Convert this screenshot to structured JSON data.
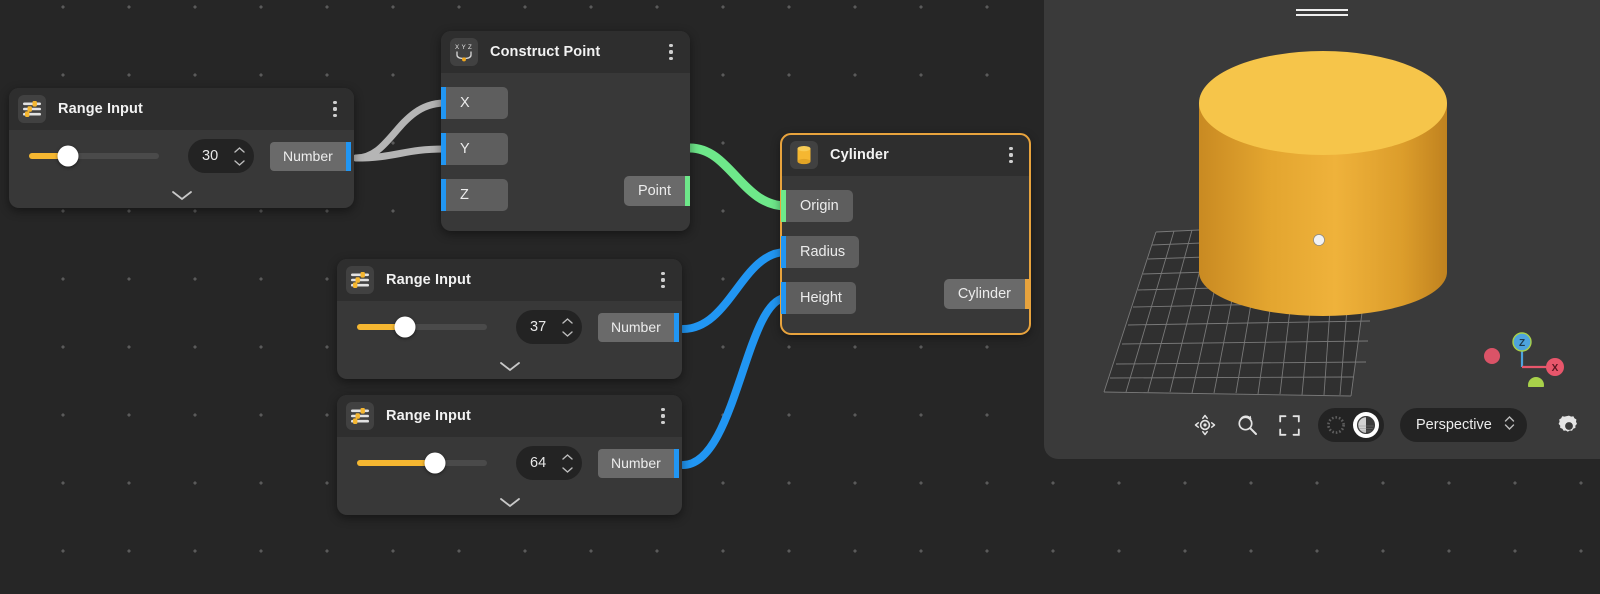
{
  "canvas": {
    "background_color": "#262626",
    "dot_color": "#5a5a5a"
  },
  "accent": {
    "selected_node_border": "#E8A33D",
    "slider_fill": "#F5B731",
    "number_cable": "#B5B5B5",
    "point_cable": "#6EE88A",
    "value_cable": "#2196F3",
    "port_blue": "#2196F3",
    "port_green": "#6EE88A"
  },
  "nodes": [
    {
      "id": "range-input-1",
      "title": "Range Input",
      "icon": "sliders-icon",
      "value": "30",
      "slider_percent": 30,
      "output_label": "Number",
      "menu_icon": "kebab-menu-icon",
      "collapse_icon": "chevron-down-icon",
      "stepper_up_icon": "chevron-up-icon",
      "stepper_down_icon": "chevron-down-icon"
    },
    {
      "id": "range-input-2",
      "title": "Range Input",
      "icon": "sliders-icon",
      "value": "37",
      "slider_percent": 37,
      "output_label": "Number",
      "menu_icon": "kebab-menu-icon",
      "collapse_icon": "chevron-down-icon",
      "stepper_up_icon": "chevron-up-icon",
      "stepper_down_icon": "chevron-down-icon"
    },
    {
      "id": "range-input-3",
      "title": "Range Input",
      "icon": "sliders-icon",
      "value": "64",
      "slider_percent": 60,
      "output_label": "Number",
      "menu_icon": "kebab-menu-icon",
      "collapse_icon": "chevron-down-icon",
      "stepper_up_icon": "chevron-up-icon",
      "stepper_down_icon": "chevron-down-icon"
    },
    {
      "id": "construct-point",
      "title": "Construct Point",
      "icon": "xyz-point-icon",
      "menu_icon": "kebab-menu-icon",
      "inputs": [
        {
          "label": "X",
          "port_color": "#2196F3"
        },
        {
          "label": "Y",
          "port_color": "#2196F3"
        },
        {
          "label": "Z",
          "port_color": "#2196F3"
        }
      ],
      "outputs": [
        {
          "label": "Point",
          "port_color": "#6EE88A"
        }
      ]
    },
    {
      "id": "cylinder",
      "title": "Cylinder",
      "icon": "cylinder-icon",
      "menu_icon": "kebab-menu-icon",
      "selected": true,
      "inputs": [
        {
          "label": "Origin",
          "port_color": "#6EE88A"
        },
        {
          "label": "Radius",
          "port_color": "#2196F3"
        },
        {
          "label": "Height",
          "port_color": "#2196F3"
        }
      ],
      "outputs": [
        {
          "label": "Cylinder",
          "port_color": "#E8A33D"
        }
      ]
    }
  ],
  "viewport": {
    "drag_handle_icon": "drag-handle-icon",
    "background_color": "#3A3A3A",
    "object_color": "#E8A83C",
    "object_top_color": "#F6C košice",
    "toolbar": {
      "pan_label": "",
      "pan_icon": "pan-orbit-icon",
      "zoom_icon": "zoom-search-icon",
      "fit_icon": "fit-to-screen-icon",
      "shading_wireframe_icon": "wireframe-shading-icon",
      "shading_shaded_icon": "shaded-view-icon",
      "projection": "Perspective",
      "projection_chevrons_icon": "chevron-up-down-icon",
      "settings_icon": "gear-icon"
    },
    "gizmo": {
      "z_label": "Z",
      "x_label": "X",
      "z_color": "#4DA3DD",
      "x_color": "#E8566B",
      "y_color": "#A8D14A",
      "neg_x_color": "#E8566B"
    }
  }
}
